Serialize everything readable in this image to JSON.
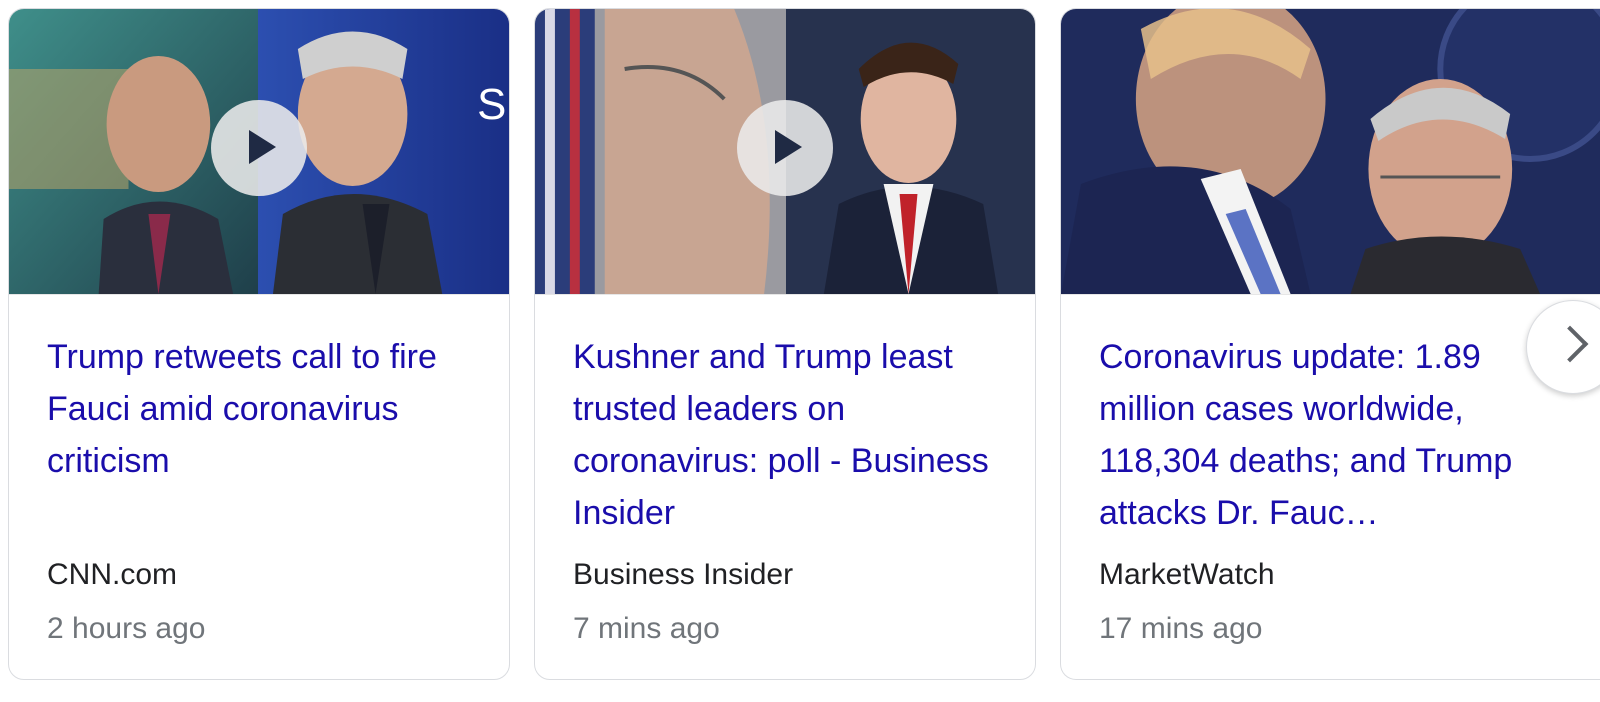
{
  "cards": [
    {
      "title": "Trump retweets call to fire Fauci amid coronavirus criticism",
      "source": "CNN.com",
      "time": "2 hours ago",
      "has_video": true
    },
    {
      "title": "Kushner and Trump least trusted leaders on coronavirus: poll - Business Insider",
      "source": "Business Insider",
      "time": "7 mins ago",
      "has_video": true
    },
    {
      "title": "Coronavirus update: 1.89 million cases worldwide, 118,304 deaths; and Trump attacks Dr. Fauc…",
      "source": "MarketWatch",
      "time": "17 mins ago",
      "has_video": false
    }
  ],
  "icons": {
    "play": "play-icon",
    "next": "chevron-right-icon"
  },
  "colors": {
    "title_link": "#1a0dab",
    "source_text": "#202124",
    "time_text": "#70757a"
  }
}
